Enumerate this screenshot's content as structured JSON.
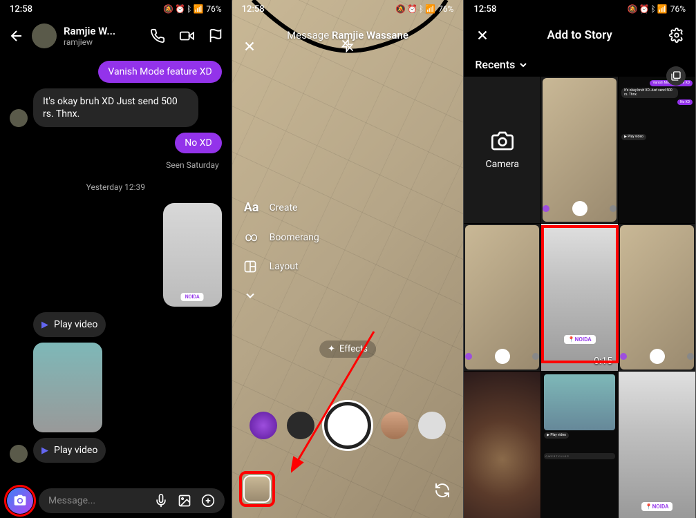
{
  "status": {
    "time": "12:58",
    "battery": "76%"
  },
  "screen1": {
    "contact_name": "Ramjie W...",
    "contact_username": "ramjiew",
    "msg_vanish": "Vanish Mode feature XD",
    "msg_okay": "It's okay bruh XD Just send 500 rs. Thnx.",
    "msg_noxd": "No XD",
    "seen_status": "Seen Saturday",
    "day_divider": "Yesterday 12:39",
    "play_video_1": "Play video",
    "play_video_2": "Play video",
    "compose_placeholder": "Message..."
  },
  "screen2": {
    "header_prefix": "Message ",
    "header_name": "Ramjie Wassane",
    "tool_create": "Create",
    "tool_create_icon": "Aa",
    "tool_boomerang": "Boomerang",
    "tool_layout": "Layout",
    "effects_label": "Effects"
  },
  "screen3": {
    "title": "Add to Story",
    "recents": "Recents",
    "camera_label": "Camera",
    "duration_1": "0:15",
    "noida": "NOIDA",
    "mini_play": "Play video"
  }
}
